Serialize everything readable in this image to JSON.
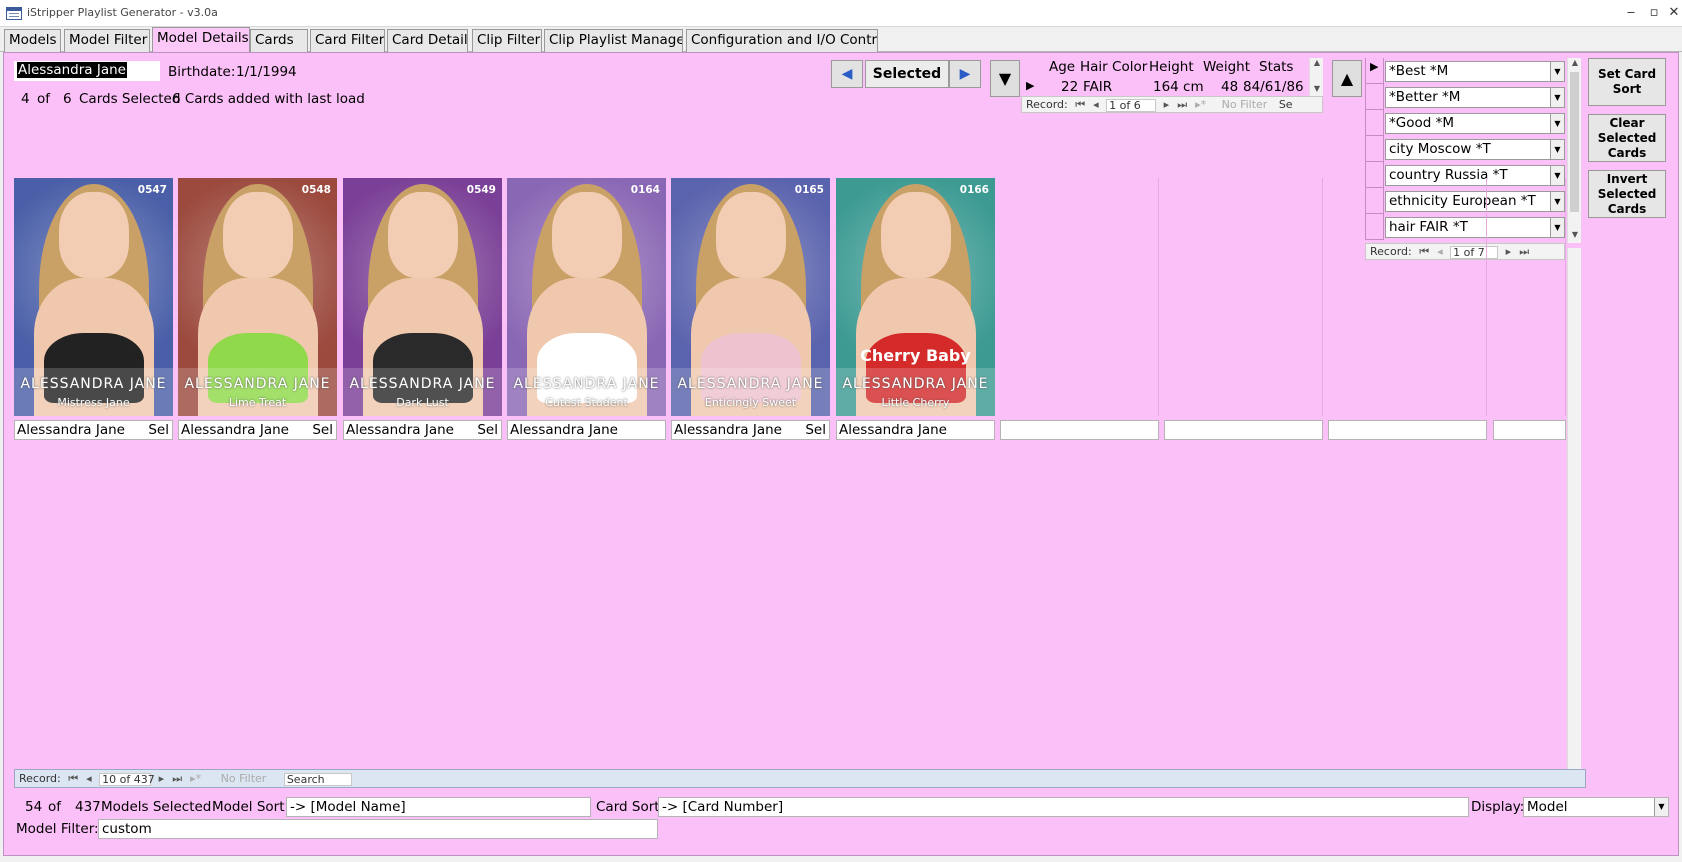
{
  "window": {
    "title": "iStripper Playlist Generator - v3.0a",
    "minimize": "‒",
    "maximize": "▫",
    "close": "✕"
  },
  "tabs": [
    {
      "label": "Models"
    },
    {
      "label": "Model Filter"
    },
    {
      "label": "Model Details",
      "active": true
    },
    {
      "label": "Cards"
    },
    {
      "label": "Card Filter"
    },
    {
      "label": "Card Details"
    },
    {
      "label": "Clip Filter"
    },
    {
      "label": "Clip Playlist Manager"
    },
    {
      "label": "Configuration and I/O Control"
    }
  ],
  "model": {
    "name": "Alessandra Jane",
    "birthdate_label": "Birthdate:",
    "birthdate": "1/1/1994",
    "cards_selected": "4",
    "of_label": "of",
    "cards_total": "6",
    "cards_selected_label": "Cards Selected",
    "cards_added": "6 Cards added with last load"
  },
  "nav": {
    "prev_icon": "◀",
    "next_icon": "▶",
    "selected_label": "Selected",
    "down_icon": "▼",
    "up_icon": "▲"
  },
  "stats": {
    "headers": [
      "Age",
      "Hair Color",
      "Height",
      "Weight",
      "Stats"
    ],
    "values": [
      "22",
      "FAIR",
      "164 cm",
      "48",
      "84/61/86"
    ],
    "record_label": "Record:",
    "record_pos": "1 of 6",
    "filter_label": "No Filter",
    "search_label": "Se"
  },
  "cards": [
    {
      "number": "0547",
      "name": "ALESSANDRA JANE",
      "title": "Mistress Jane",
      "caption": "Alessandra Jane",
      "sel": "Sel",
      "bg": "#4a5fa8",
      "top": "#222"
    },
    {
      "number": "0548",
      "name": "ALESSANDRA JANE",
      "title": "Lime Treat",
      "caption": "Alessandra Jane",
      "sel": "Sel",
      "bg": "#9c4a3e",
      "top": "#8fd94a"
    },
    {
      "number": "0549",
      "name": "ALESSANDRA JANE",
      "title": "Dark Lust",
      "caption": "Alessandra Jane",
      "sel": "Sel",
      "bg": "#7a3f96",
      "top": "#2a2a2a"
    },
    {
      "number": "0164",
      "name": "ALESSANDRA JANE",
      "title": "Cutest Student",
      "caption": "Alessandra Jane",
      "sel": "",
      "bg": "#8a67b4",
      "top": "#fff"
    },
    {
      "number": "0165",
      "name": "ALESSANDRA JANE",
      "title": "Enticingly Sweet",
      "caption": "Alessandra Jane",
      "sel": "Sel",
      "bg": "#5a63ad",
      "top": "#eec2cf"
    },
    {
      "number": "0166",
      "name": "ALESSANDRA JANE",
      "title": "Little Cherry",
      "caption": "Alessandra Jane",
      "sel": "",
      "bg": "#3c9a93",
      "top": "#d42a2a",
      "shirt_text": "Cherry Baby"
    }
  ],
  "sort_list": {
    "items": [
      "*Best *M",
      "*Better *M",
      "*Good *M",
      "city Moscow *T",
      "country Russia *T",
      "ethnicity European *T",
      "hair FAIR *T"
    ],
    "record_label": "Record:",
    "record_pos": "1 of 7"
  },
  "side_buttons": {
    "set_card_sort": "Set Card\nSort",
    "clear_selected": "Clear\nSelected\nCards",
    "invert_selected": "Invert\nSelected\nCards"
  },
  "main_record": {
    "record_label": "Record:",
    "record_pos": "10 of 437",
    "filter_label": "No Filter",
    "search_label": "Search"
  },
  "footer": {
    "models_selected": "54",
    "of_label": "of",
    "models_total": "437",
    "models_selected_label": "Models Selected",
    "model_sort_label": "Model Sort:",
    "model_sort": "-> [Model Name]",
    "card_sort_label": "Card Sort:",
    "card_sort": "-> [Card Number]",
    "display_label": "Display:",
    "display": "Model",
    "model_filter_label": "Model Filter:",
    "model_filter": "custom"
  }
}
